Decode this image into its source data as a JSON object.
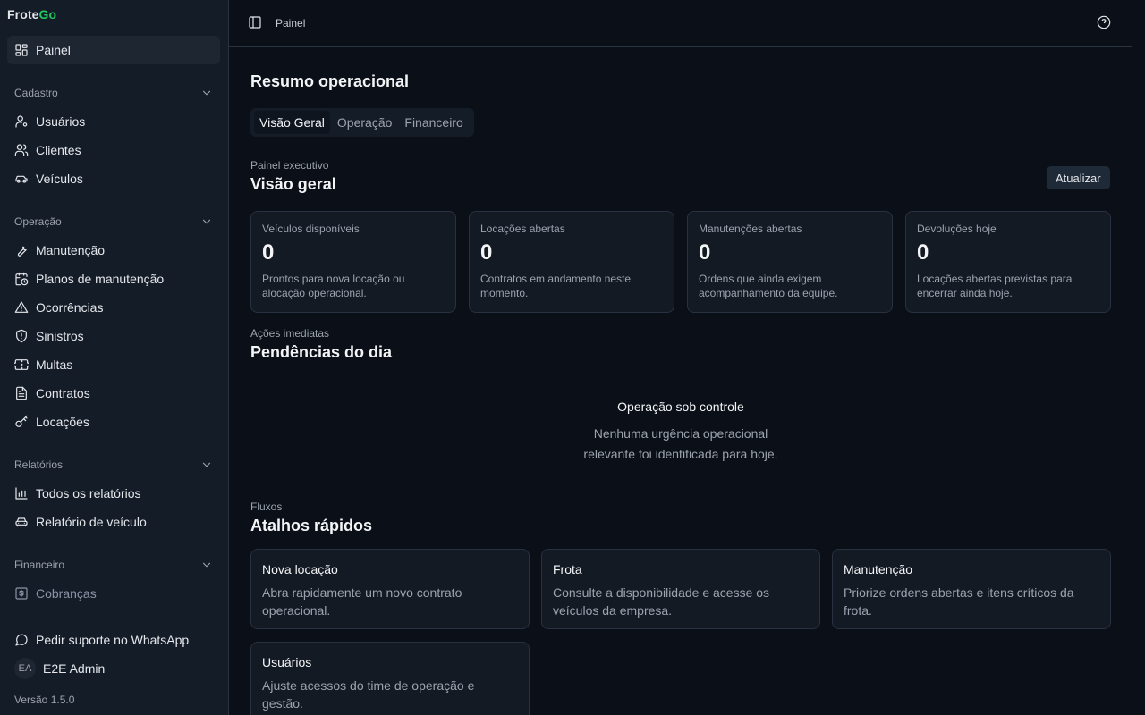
{
  "brand": {
    "part1": "Frote",
    "part2": "Go"
  },
  "sidebar": {
    "painel": "Painel",
    "groups": {
      "cadastro": "Cadastro",
      "operacao": "Operação",
      "relatorios": "Relatórios",
      "financeiro": "Financeiro"
    },
    "cadastro_items": [
      "Usuários",
      "Clientes",
      "Veículos"
    ],
    "operacao_items": [
      "Manutenção",
      "Planos de manutenção",
      "Ocorrências",
      "Sinistros",
      "Multas",
      "Contratos",
      "Locações"
    ],
    "relatorios_items": [
      "Todos os relatórios",
      "Relatório de veículo"
    ],
    "financeiro_items": [
      "Cobranças"
    ],
    "support": "Pedir suporte no WhatsApp",
    "user": {
      "initials": "EA",
      "name": "E2E Admin"
    },
    "version": "Versão 1.5.0"
  },
  "topbar": {
    "breadcrumb": "Painel"
  },
  "main": {
    "title": "Resumo operacional",
    "tabs": [
      "Visão Geral",
      "Operação",
      "Financeiro"
    ],
    "overview": {
      "eyebrow": "Painel executivo",
      "title": "Visão geral",
      "refresh": "Atualizar"
    },
    "stats": [
      {
        "label": "Veículos disponíveis",
        "value": "0",
        "desc": "Prontos para nova locação ou alocação operacional."
      },
      {
        "label": "Locações abertas",
        "value": "0",
        "desc": "Contratos em andamento neste momento."
      },
      {
        "label": "Manutenções abertas",
        "value": "0",
        "desc": "Ordens que ainda exigem acompanhamento da equipe."
      },
      {
        "label": "Devoluções hoje",
        "value": "0",
        "desc": "Locações abertas previstas para encerrar ainda hoje."
      }
    ],
    "pending": {
      "eyebrow": "Ações imediatas",
      "title": "Pendências do dia",
      "empty_title": "Operação sob controle",
      "empty_desc": "Nenhuma urgência operacional relevante foi identificada para hoje."
    },
    "shortcuts": {
      "eyebrow": "Fluxos",
      "title": "Atalhos rápidos",
      "cards": [
        {
          "title": "Nova locação",
          "desc": "Abra rapidamente um novo contrato operacional."
        },
        {
          "title": "Frota",
          "desc": "Consulte a disponibilidade e acesse os veículos da empresa."
        },
        {
          "title": "Manutenção",
          "desc": "Priorize ordens abertas e itens críticos da frota."
        },
        {
          "title": "Usuários",
          "desc": "Ajuste acessos do time de operação e gestão."
        }
      ]
    }
  }
}
